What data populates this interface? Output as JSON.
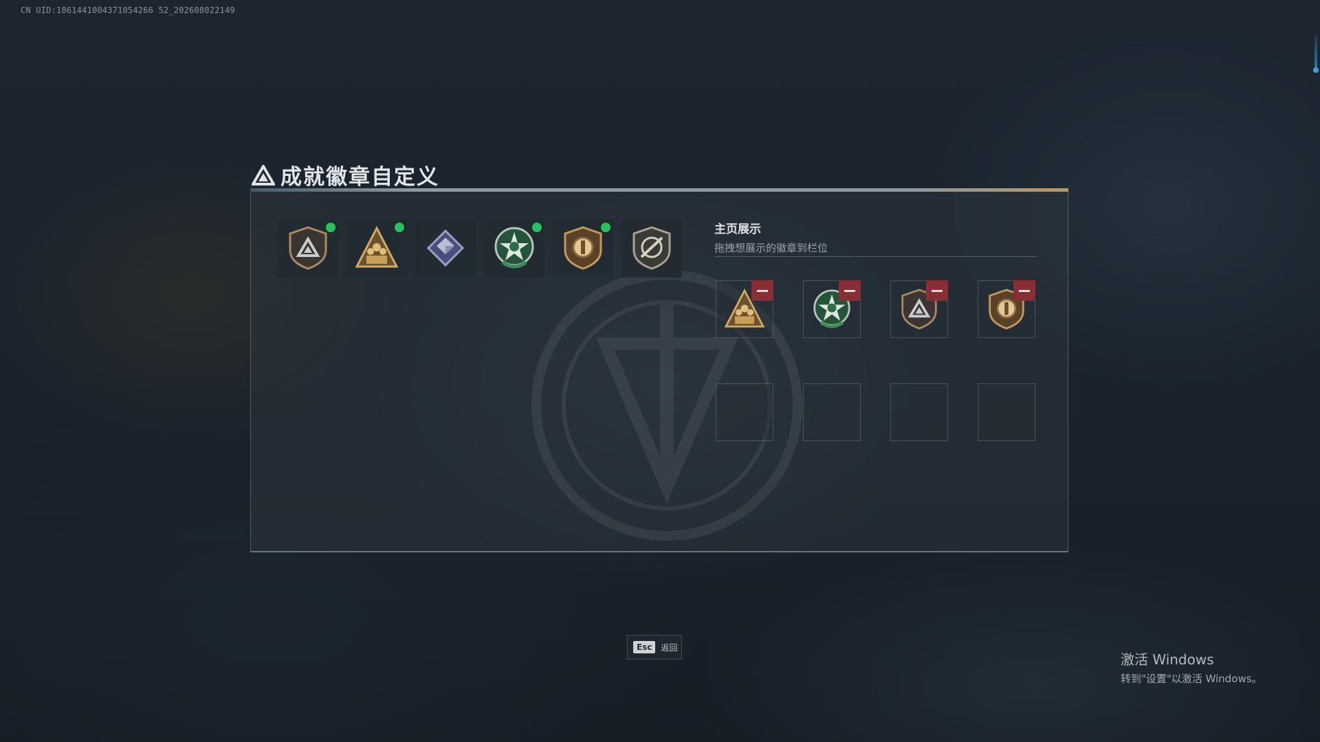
{
  "uid_text": "CN UID:1861441004371054266 52_202608022149",
  "panel": {
    "title": "成就徽章自定义",
    "title_icon": "triangle-emblem-icon"
  },
  "badges": [
    {
      "icon": "triangle-shield-badge",
      "selected": true
    },
    {
      "icon": "squad-triangle-badge",
      "selected": true
    },
    {
      "icon": "crystal-cube-badge",
      "selected": false
    },
    {
      "icon": "green-star-wreath-badge",
      "selected": true
    },
    {
      "icon": "orb-shield-badge",
      "selected": true
    },
    {
      "icon": "crossed-sword-shield-badge",
      "selected": false
    }
  ],
  "display": {
    "title": "主页展示",
    "subtitle": "拖拽想展示的徽章到栏位",
    "slots": [
      {
        "icon": "squad-triangle-badge",
        "removable": true
      },
      {
        "icon": "green-star-wreath-badge",
        "removable": true
      },
      {
        "icon": "triangle-shield-badge",
        "removable": true
      },
      {
        "icon": "orb-shield-badge",
        "removable": true
      },
      {
        "icon": null,
        "removable": false
      },
      {
        "icon": null,
        "removable": false
      },
      {
        "icon": null,
        "removable": false
      },
      {
        "icon": null,
        "removable": false
      }
    ]
  },
  "footer": {
    "esc_key": "Esc",
    "esc_label": "返回"
  },
  "windows_watermark": {
    "line1": "激活 Windows",
    "line2": "转到\"设置\"以激活 Windows。"
  },
  "colors": {
    "selected_dot": "#28c060",
    "remove_button": "#8a2e36",
    "badge_gold": "#b08a50",
    "badge_green": "#2e6a44"
  }
}
